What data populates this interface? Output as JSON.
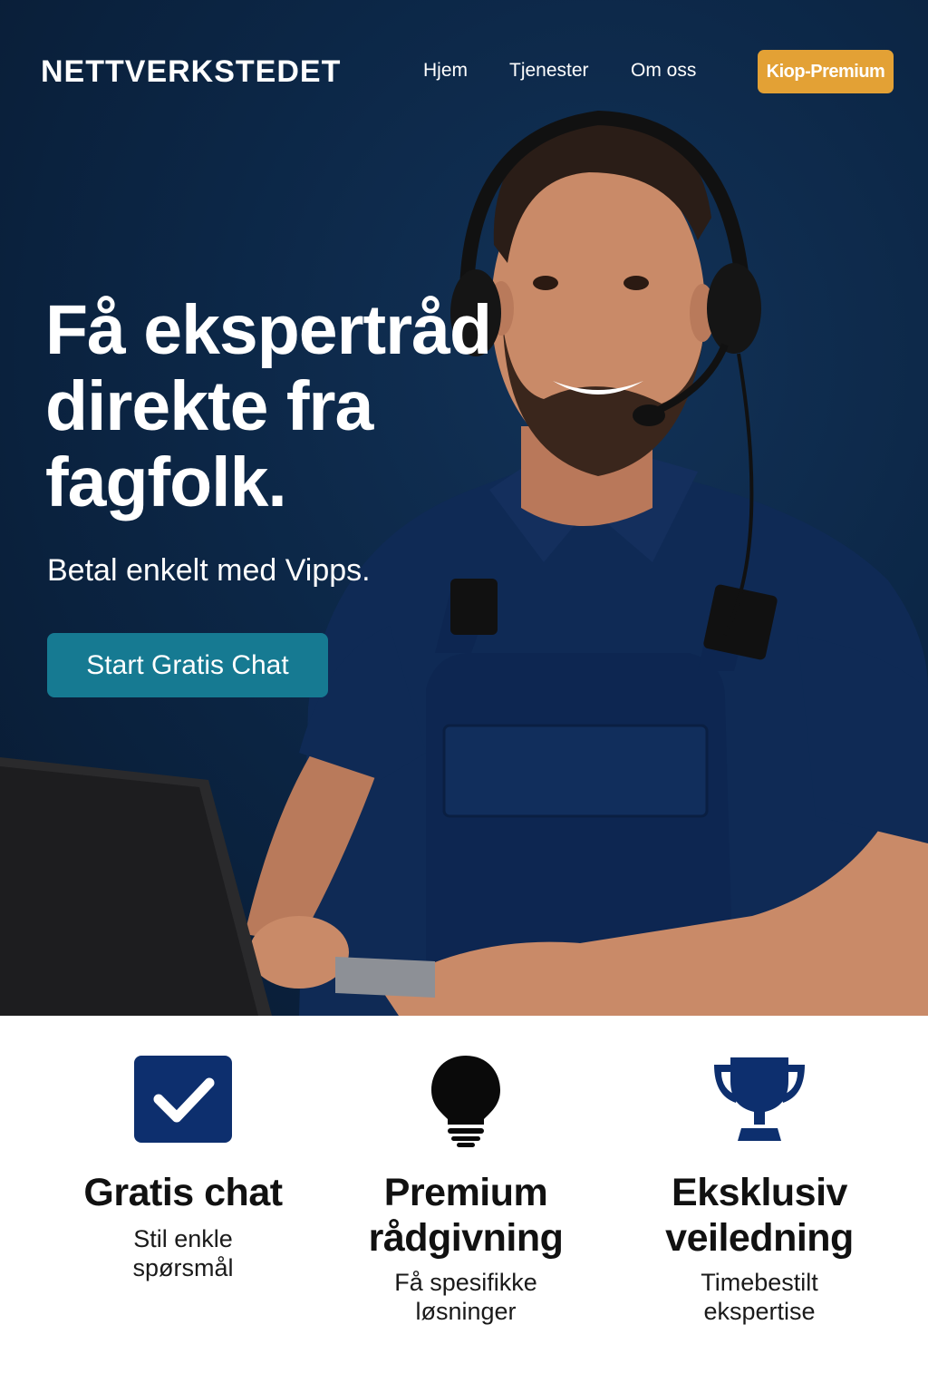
{
  "header": {
    "brand": "NETTVERKSTEDET",
    "nav": [
      "Hjem",
      "Tjenester",
      "Om oss"
    ],
    "premium_button": "Kiop-Premium"
  },
  "hero": {
    "headline_lines": [
      "Få ekspertråd",
      "direkte fra",
      "fagfolk."
    ],
    "subline": "Betal enkelt med Vipps.",
    "cta": "Start Gratis Chat"
  },
  "features": [
    {
      "icon": "checkbox-icon",
      "title_lines": [
        "Gratis chat"
      ],
      "desc_lines": [
        "Stil enkle",
        "spørsmål"
      ]
    },
    {
      "icon": "lightbulb-icon",
      "title_lines": [
        "Premium",
        "rådgivning"
      ],
      "desc_lines": [
        "Få spesifikke",
        "løsninger"
      ]
    },
    {
      "icon": "trophy-icon",
      "title_lines": [
        "Eksklusiv",
        "veiledning"
      ],
      "desc_lines": [
        "Timebestilt",
        "ekspertise"
      ]
    }
  ],
  "colors": {
    "hero_background": "#0c2747",
    "premium_button": "#e3a135",
    "cta_button": "#167a92",
    "icon_blue": "#0d2f6e"
  }
}
